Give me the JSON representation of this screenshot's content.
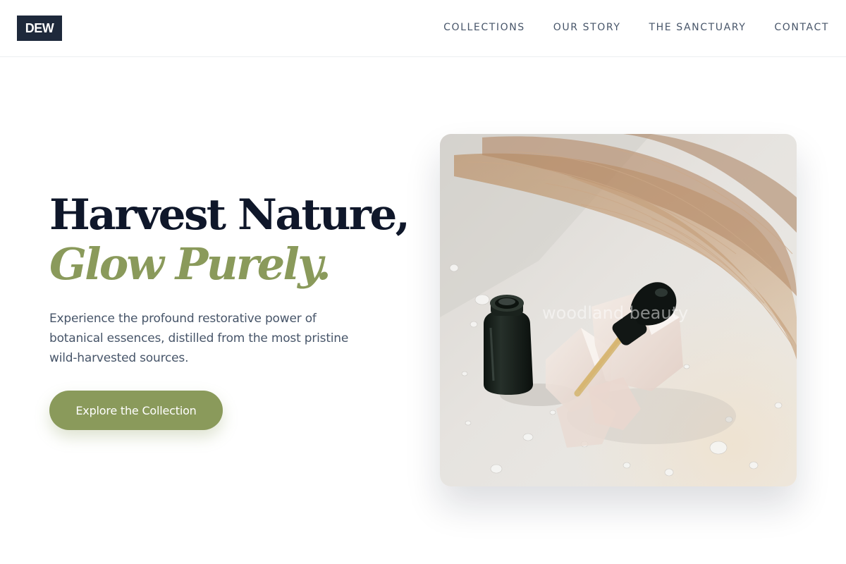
{
  "brand": {
    "logo_text": "DEW"
  },
  "nav": {
    "items": [
      {
        "label": "COLLECTIONS"
      },
      {
        "label": "OUR STORY"
      },
      {
        "label": "THE SANCTUARY"
      },
      {
        "label": "CONTACT"
      }
    ]
  },
  "hero": {
    "headline_line1": "Harvest Nature,",
    "headline_line2": "Glow Purely.",
    "subtext": "Experience the profound restorative power of botanical essences, distilled from the most pristine wild-harvested sources.",
    "cta_label": "Explore the Collection",
    "image_watermark": "woodland beauty"
  },
  "colors": {
    "accent": "#8a9a5b",
    "heading": "#0f172a",
    "logo_bg": "#1e293b",
    "body_text": "#475569"
  }
}
